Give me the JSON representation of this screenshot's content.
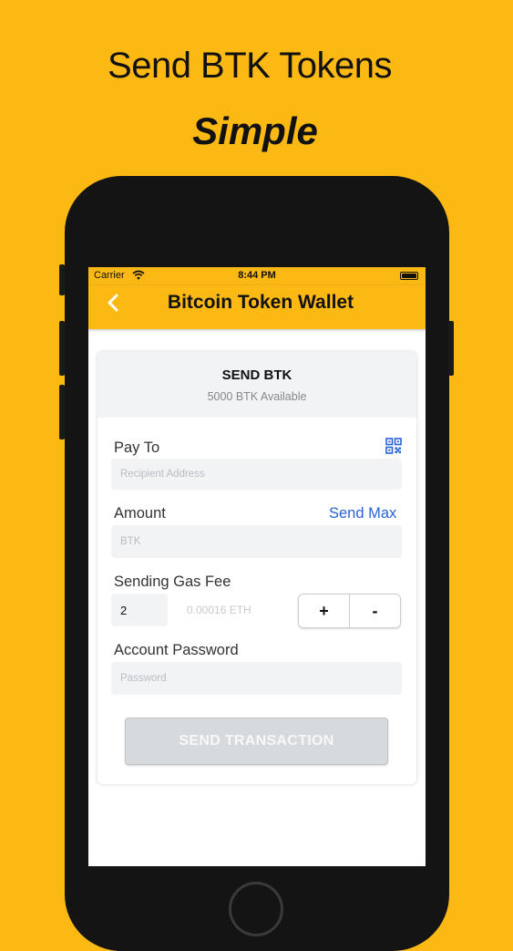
{
  "promo": {
    "title": "Send BTK Tokens",
    "subtitle": "Simple"
  },
  "status_bar": {
    "carrier": "Carrier",
    "time": "8:44 PM"
  },
  "nav": {
    "title": "Bitcoin Token Wallet",
    "back_icon": "chevron-left-icon"
  },
  "card": {
    "title": "SEND BTK",
    "available": "5000 BTK Available"
  },
  "form": {
    "pay_to": {
      "label": "Pay To",
      "placeholder": "Recipient Address",
      "icon": "qr-code-icon"
    },
    "amount": {
      "label": "Amount",
      "placeholder": "BTK",
      "send_max": "Send Max"
    },
    "gas_fee": {
      "label": "Sending Gas Fee",
      "value": "2",
      "eth_value": "0.00016 ETH",
      "plus": "+",
      "minus": "-"
    },
    "password": {
      "label": "Account Password",
      "placeholder": "Password"
    },
    "submit": "SEND TRANSACTION"
  },
  "colors": {
    "brand": "#FDB913",
    "link": "#2962D6",
    "input_bg": "#F1F3F5",
    "disabled_button": "#D7DADC"
  }
}
